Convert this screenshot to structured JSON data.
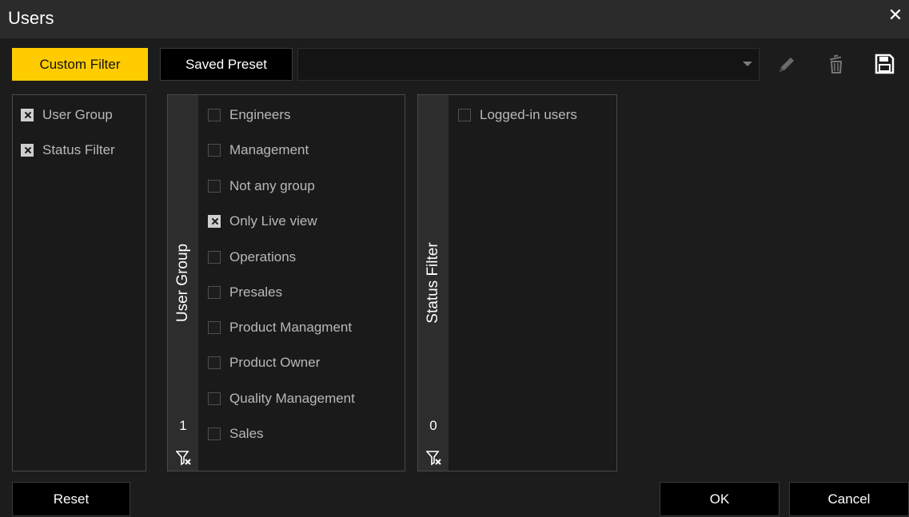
{
  "window": {
    "title": "Users",
    "close_glyph": "✕"
  },
  "toolbar": {
    "custom_filter_label": "Custom Filter",
    "saved_preset_label": "Saved Preset",
    "preset_value": "",
    "icons": [
      "edit-icon",
      "delete-icon",
      "save-icon"
    ]
  },
  "filters": [
    {
      "label": "User Group",
      "checked": true
    },
    {
      "label": "Status Filter",
      "checked": true
    }
  ],
  "user_group": {
    "title": "User Group",
    "count": "1",
    "items": [
      {
        "label": "Engineers",
        "checked": false
      },
      {
        "label": "Management",
        "checked": false
      },
      {
        "label": "Not any group",
        "checked": false
      },
      {
        "label": "Only Live view",
        "checked": true
      },
      {
        "label": "Operations",
        "checked": false
      },
      {
        "label": "Presales",
        "checked": false
      },
      {
        "label": "Product Managment",
        "checked": false
      },
      {
        "label": "Product Owner",
        "checked": false
      },
      {
        "label": "Quality Management",
        "checked": false
      },
      {
        "label": "Sales",
        "checked": false
      }
    ]
  },
  "status_filter": {
    "title": "Status Filter",
    "count": "0",
    "items": [
      {
        "label": "Logged-in users",
        "checked": false
      }
    ]
  },
  "footer": {
    "reset_label": "Reset",
    "ok_label": "OK",
    "cancel_label": "Cancel"
  },
  "colors": {
    "accent": "#ffcc00",
    "background": "#1c1c1c",
    "titlebar": "#2b2b2b"
  }
}
